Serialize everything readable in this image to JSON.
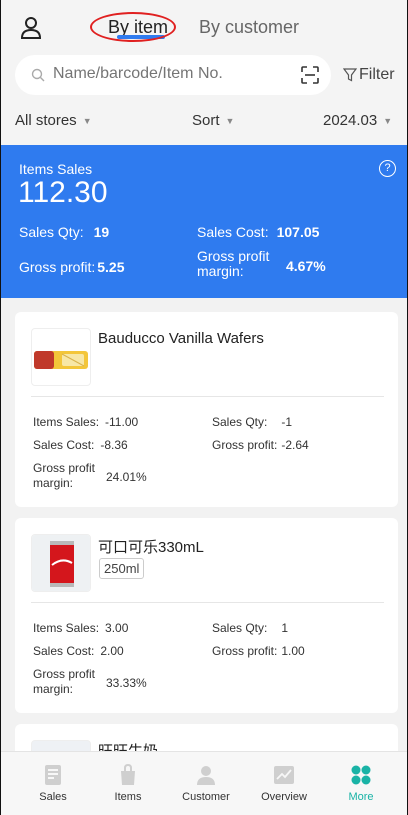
{
  "header": {
    "tabs": [
      {
        "label": "By item",
        "active": true
      },
      {
        "label": "By customer",
        "active": false
      }
    ],
    "search": {
      "placeholder": "Name/barcode/Item No."
    },
    "filter_label": "Filter",
    "store_select": "All stores",
    "sort_select": "Sort",
    "date_select": "2024.03"
  },
  "summary": {
    "title": "Items Sales",
    "value": "112.30",
    "sales_qty_label": "Sales Qty:",
    "sales_qty": "19",
    "sales_cost_label": "Sales Cost:",
    "sales_cost": "107.05",
    "gross_profit_label": "Gross profit:",
    "gross_profit": "5.25",
    "gross_margin_label": "Gross profit margin:",
    "gross_margin": "4.67%",
    "help_icon": "?"
  },
  "items": [
    {
      "name": "Bauducco Vanilla Wafers",
      "spec": "",
      "thumb_icon": "wafer-package",
      "items_sales_label": "Items Sales:",
      "items_sales": "-11.00",
      "sales_qty_label": "Sales Qty:",
      "sales_qty": "-1",
      "sales_cost_label": "Sales Cost:",
      "sales_cost": "-8.36",
      "gross_profit_label": "Gross profit:",
      "gross_profit": "-2.64",
      "gross_margin_label": "Gross profit margin:",
      "gross_margin": "24.01%"
    },
    {
      "name": "可口可乐330mL",
      "spec": "250ml",
      "thumb_icon": "cola-can",
      "items_sales_label": "Items Sales:",
      "items_sales": "3.00",
      "sales_qty_label": "Sales Qty:",
      "sales_qty": "1",
      "sales_cost_label": "Sales Cost:",
      "sales_cost": "2.00",
      "gross_profit_label": "Gross profit:",
      "gross_profit": "1.00",
      "gross_margin_label": "Gross profit margin:",
      "gross_margin": "33.33%"
    },
    {
      "name": "旺旺牛奶"
    }
  ],
  "nav": [
    {
      "label": "Sales",
      "icon": "sales-icon",
      "active": false
    },
    {
      "label": "Items",
      "icon": "items-bag-icon",
      "active": false
    },
    {
      "label": "Customer",
      "icon": "customer-icon",
      "active": false
    },
    {
      "label": "Overview",
      "icon": "overview-chart-icon",
      "active": false
    },
    {
      "label": "More",
      "icon": "more-grid-icon",
      "active": true
    }
  ],
  "colors": {
    "accent": "#2f7bef",
    "active_nav": "#19b3a6",
    "annotation_circle": "#e02020"
  }
}
